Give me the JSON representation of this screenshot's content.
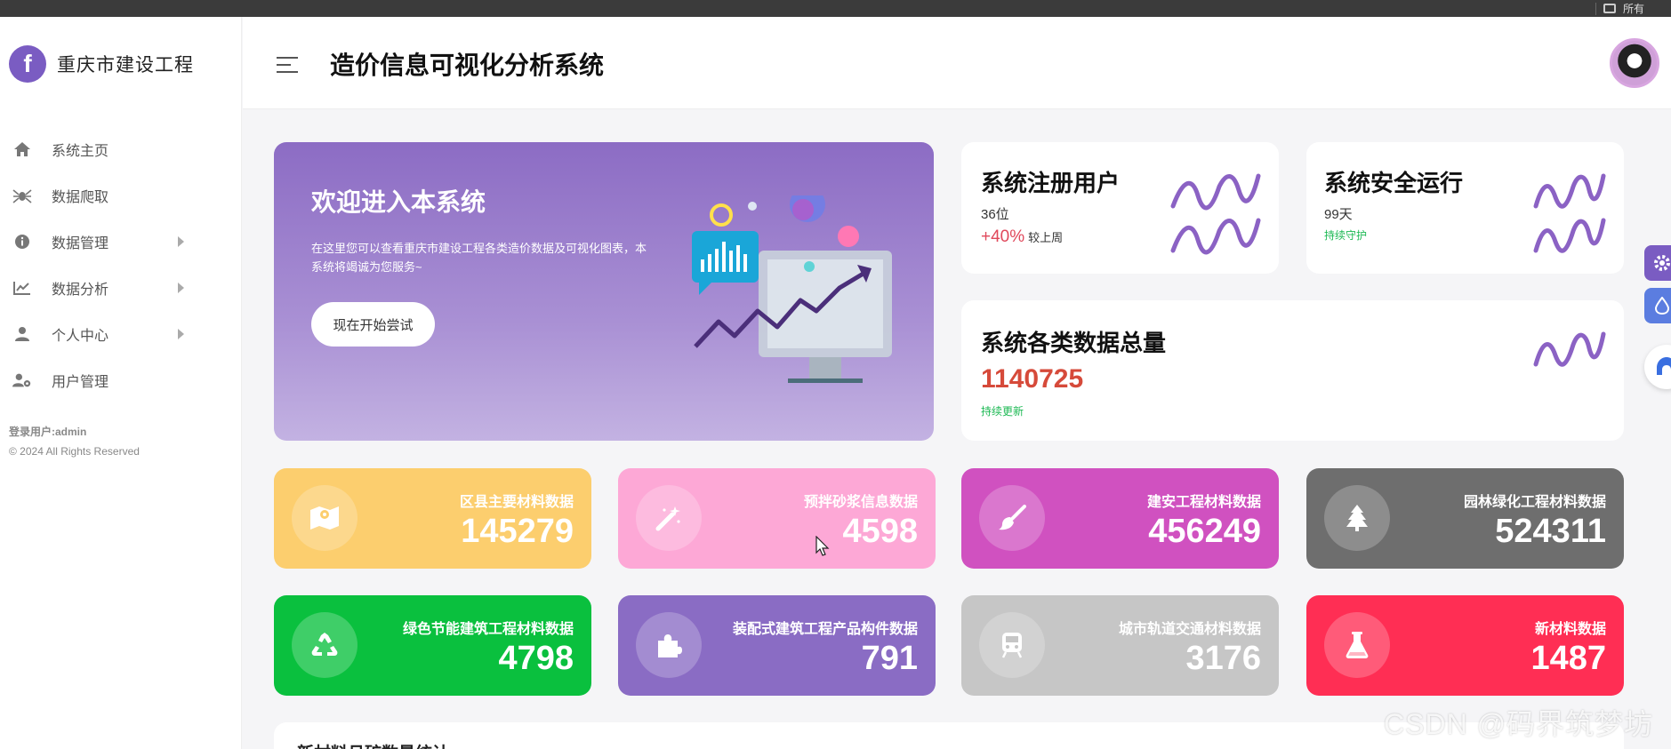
{
  "topbar": {
    "right_label": "所有"
  },
  "brand": {
    "logo_letter": "f",
    "name": "重庆市建设工程"
  },
  "header": {
    "title": "造价信息可视化分析系统"
  },
  "sidebar": {
    "items": [
      {
        "label": "系统主页",
        "icon": "home-icon",
        "has_arrow": false
      },
      {
        "label": "数据爬取",
        "icon": "spider-icon",
        "has_arrow": false
      },
      {
        "label": "数据管理",
        "icon": "info-icon",
        "has_arrow": true
      },
      {
        "label": "数据分析",
        "icon": "line-chart-icon",
        "has_arrow": true
      },
      {
        "label": "个人中心",
        "icon": "user-icon",
        "has_arrow": true
      },
      {
        "label": "用户管理",
        "icon": "user-cog-icon",
        "has_arrow": false
      }
    ],
    "footer_user": "登录用户:admin",
    "footer_copyright": "© 2024 All Rights Reserved"
  },
  "hero": {
    "title": "欢迎进入本系统",
    "description": "在这里您可以查看重庆市建设工程各类造价数据及可视化图表，本系统将竭诚为您服务~",
    "button": "现在开始尝试"
  },
  "stats": {
    "users": {
      "title": "系统注册用户",
      "value": "36位",
      "change": "+40%",
      "change_note": "较上周"
    },
    "uptime": {
      "title": "系统安全运行",
      "value": "99天",
      "note": "持续守护"
    },
    "total": {
      "title": "系统各类数据总量",
      "value": "1140725",
      "note": "持续更新"
    }
  },
  "tiles": [
    {
      "label": "区县主要材料数据",
      "value": "145279",
      "color": "#fcce6e",
      "icon": "map-icon"
    },
    {
      "label": "预拌砂浆信息数据",
      "value": "4598",
      "color": "#fda8d6",
      "icon": "magic-wand-icon"
    },
    {
      "label": "建安工程材料数据",
      "value": "456249",
      "color": "#d051c0",
      "icon": "brush-icon"
    },
    {
      "label": "园林绿化工程材料数据",
      "value": "524311",
      "color": "#6e6e6e",
      "icon": "tree-icon"
    },
    {
      "label": "绿色节能建筑工程材料数据",
      "value": "4798",
      "color": "#0ac03e",
      "icon": "recycle-icon"
    },
    {
      "label": "装配式建筑工程产品构件数据",
      "value": "791",
      "color": "#8a6cc4",
      "icon": "puzzle-icon"
    },
    {
      "label": "城市轨道交通材料数据",
      "value": "3176",
      "color": "#c6c6c6",
      "icon": "train-icon"
    },
    {
      "label": "新材料数据",
      "value": "1487",
      "color": "#ff2e54",
      "icon": "flask-icon"
    }
  ],
  "bottom": {
    "title": "新材料月矿数量统计"
  },
  "floating": [
    {
      "icon": "gear-icon",
      "color": "#7a5cc2"
    },
    {
      "icon": "drop-icon",
      "color": "#5b7de0"
    },
    {
      "icon": "assistant-icon",
      "color": "#ffffff"
    }
  ],
  "watermark": "CSDN @码界筑梦坊"
}
